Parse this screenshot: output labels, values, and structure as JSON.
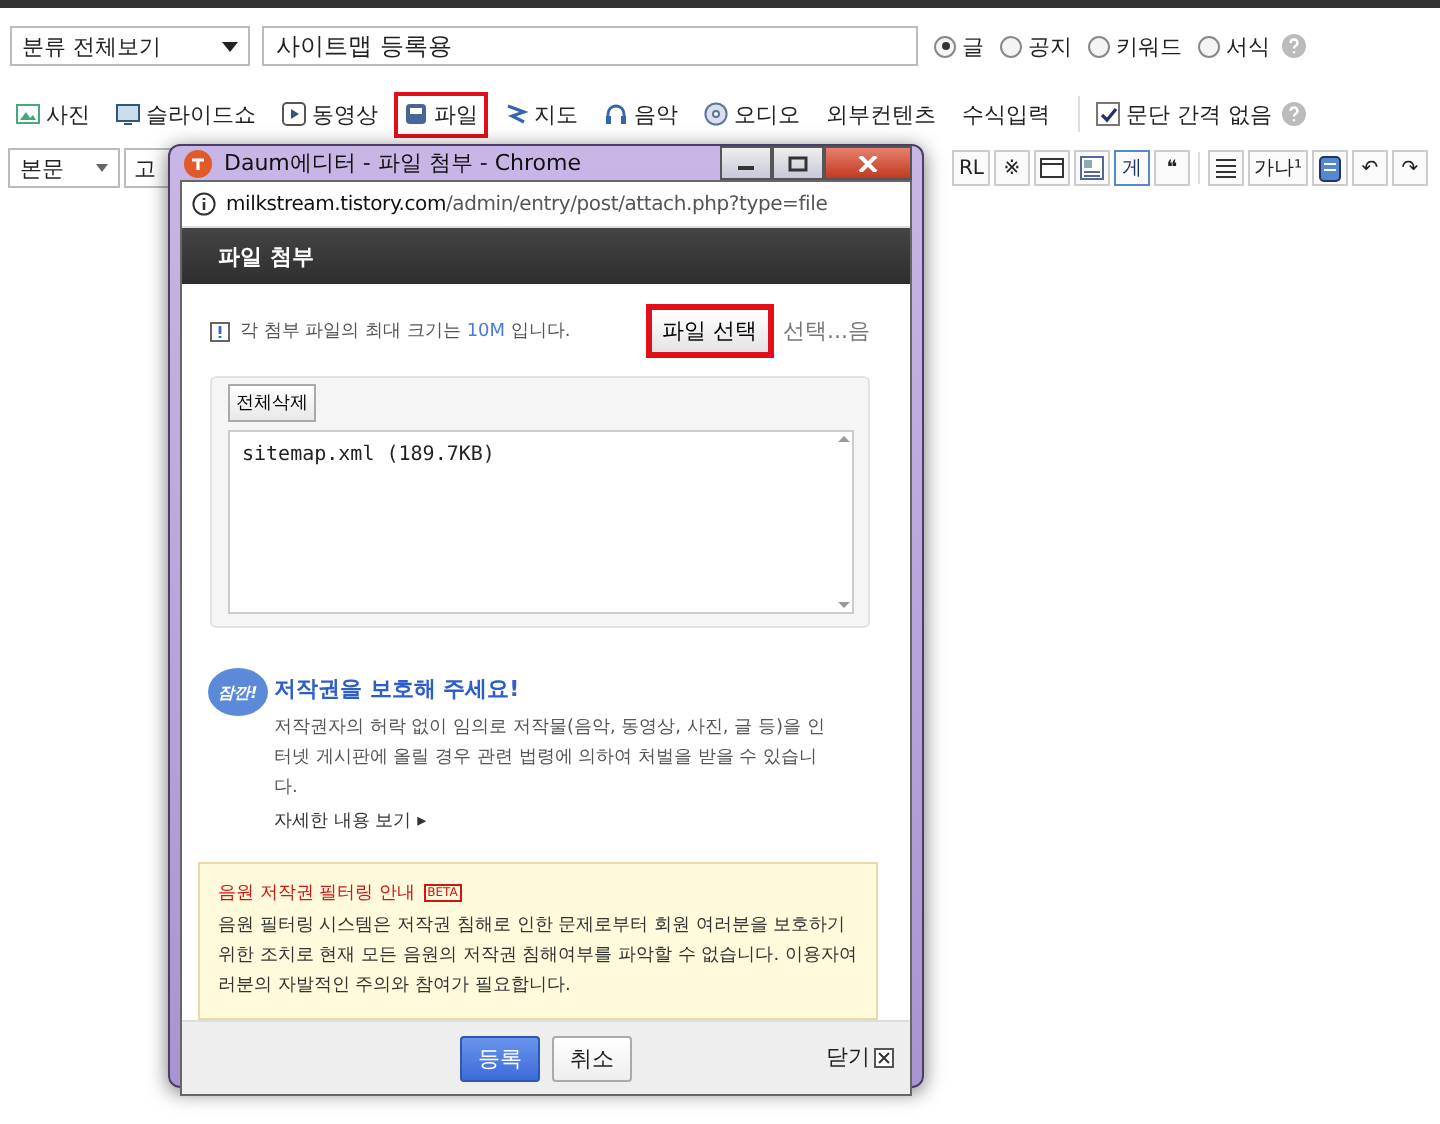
{
  "category_select": {
    "value": "분류 전체보기"
  },
  "title_field": {
    "value": "사이트맵 등록용"
  },
  "post_types": [
    {
      "label": "글",
      "selected": true
    },
    {
      "label": "공지",
      "selected": false
    },
    {
      "label": "키워드",
      "selected": false
    },
    {
      "label": "서식",
      "selected": false
    }
  ],
  "insert_toolbar": [
    {
      "label": "사진",
      "kind": "photo",
      "highlighted": false
    },
    {
      "label": "슬라이드쇼",
      "kind": "slides",
      "highlighted": false
    },
    {
      "label": "동영상",
      "kind": "video",
      "highlighted": false
    },
    {
      "label": "파일",
      "kind": "file",
      "highlighted": true
    },
    {
      "label": "지도",
      "kind": "map",
      "highlighted": false
    },
    {
      "label": "음악",
      "kind": "music",
      "highlighted": false
    },
    {
      "label": "오디오",
      "kind": "audio",
      "highlighted": false
    },
    {
      "label": "외부컨텐츠",
      "kind": "text",
      "highlighted": false
    },
    {
      "label": "수식입력",
      "kind": "text",
      "highlighted": false
    }
  ],
  "no_paragraph_gap": {
    "label": "문단 간격 없음",
    "checked": true
  },
  "format_toolbar": {
    "style_select": "본문",
    "font_select": "고",
    "buttons": [
      {
        "label": "RL",
        "kind": "text"
      },
      {
        "label": "※",
        "kind": "text"
      },
      {
        "kind": "table"
      },
      {
        "kind": "box"
      },
      {
        "kind": "glyph",
        "label": "게"
      },
      {
        "kind": "text",
        "label": "❝"
      },
      {
        "kind": "divider"
      },
      {
        "kind": "lines"
      },
      {
        "kind": "text",
        "label": "가나¹"
      },
      {
        "kind": "doc"
      },
      {
        "kind": "text",
        "label": "↶"
      },
      {
        "kind": "text",
        "label": "↷"
      }
    ]
  },
  "popup": {
    "title": "Daum에디터 - 파일 첨부 - Chrome",
    "url_host": "milkstream.tistory.com",
    "url_path": "/admin/entry/post/attach.php?type=file",
    "header": "파일 첨부",
    "notice_before": "각 첨부 파일의 최대 크기는 ",
    "notice_size": "10M",
    "notice_after": " 입니다.",
    "file_button": {
      "label": "파일 선택",
      "highlighted": true
    },
    "file_status": "선택...음",
    "delete_all": "전체삭제",
    "files": [
      "sitemap.xml (189.7KB)"
    ],
    "copyright_badge": "잠깐!",
    "copyright_title": "저작권을 보호해 주세요!",
    "copyright_text": "저작권자의 허락 없이 임의로 저작물(음악, 동영상, 사진, 글 등)을 인터넷 게시판에 올릴 경우 관련 법령에 의하여 처벌을 받을 수 있습니다.",
    "more_link": "자세한 내용 보기 ▸",
    "filter_title": "음원 저작권 필터링 안내",
    "filter_badge": "BETA",
    "filter_text": "음원 필터링 시스템은 저작권 침해로 인한 문제로부터 회원 여러분을 보호하기 위한 조치로 현재 모든 음원의 저작권 침해여부를 파악할 수 없습니다. 이용자여러분의 자발적인 주의와 참여가 필요합니다.",
    "submit": "등록",
    "cancel": "취소",
    "close": "닫기"
  }
}
